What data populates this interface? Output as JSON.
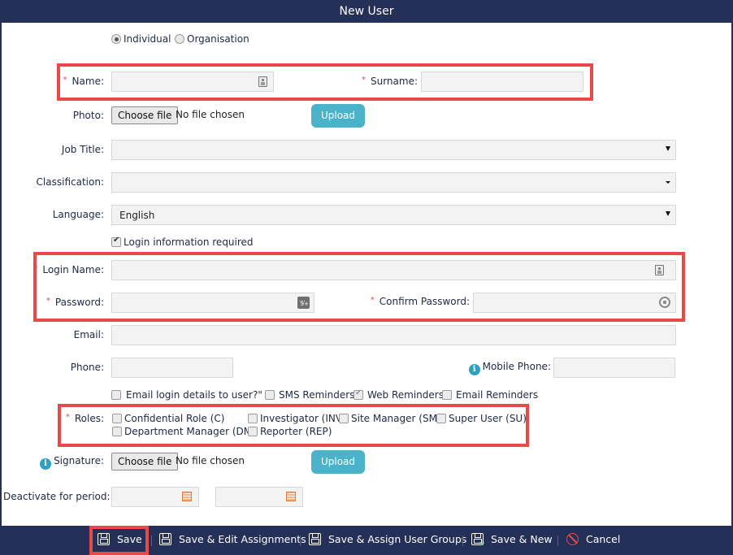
{
  "window": {
    "title": "New User"
  },
  "user_type": {
    "options": [
      {
        "label": "Individual",
        "selected": true
      },
      {
        "label": "Organisation",
        "selected": false
      }
    ]
  },
  "fields": {
    "name": {
      "label": "Name:",
      "required": "*",
      "value": ""
    },
    "surname": {
      "label": "Surname:",
      "required": "*",
      "value": ""
    },
    "photo": {
      "label": "Photo:",
      "choose_label": "Choose file",
      "status": "No file chosen",
      "upload_label": "Upload"
    },
    "job_title": {
      "label": "Job Title:",
      "value": ""
    },
    "classification": {
      "label": "Classification:",
      "value": ""
    },
    "language": {
      "label": "Language:",
      "value": "English"
    },
    "login_required": {
      "label": "Login information required",
      "checked": true
    },
    "login_name": {
      "label": "Login Name:",
      "required": "*",
      "value": ""
    },
    "password": {
      "label": "Password:",
      "required": "*",
      "value": ""
    },
    "confirm_password": {
      "label": "Confirm Password:",
      "required": "*",
      "value": ""
    },
    "email": {
      "label": "Email:",
      "value": ""
    },
    "phone": {
      "label": "Phone:",
      "value": ""
    },
    "mobile_phone": {
      "label": "Mobile Phone:",
      "value": ""
    },
    "signature": {
      "label": "Signature:",
      "choose_label": "Choose file",
      "status": "No file chosen",
      "upload_label": "Upload"
    },
    "deactivate": {
      "label": "Deactivate for period:",
      "from": "",
      "to": ""
    }
  },
  "notifications": [
    {
      "label": "Email login details to user?\"",
      "checked": false
    },
    {
      "label": "SMS Reminders",
      "checked": false
    },
    {
      "label": "Web Reminders",
      "checked": true
    },
    {
      "label": "Email Reminders",
      "checked": false
    }
  ],
  "roles": {
    "label": "Roles:",
    "required": "*",
    "items": [
      {
        "label": "Confidential Role (C)",
        "checked": false
      },
      {
        "label": "Investigator (INV)",
        "checked": false
      },
      {
        "label": "Site Manager (SM)",
        "checked": false
      },
      {
        "label": "Super User (SU)",
        "checked": false
      },
      {
        "label": "Department Manager (DM)",
        "checked": false
      },
      {
        "label": "Reporter (REP)",
        "checked": false
      }
    ]
  },
  "footer": {
    "buttons": [
      {
        "label": "Save",
        "icon": "floppy-disk-icon"
      },
      {
        "label": "Save & Edit Assignments",
        "icon": "floppy-disk-icon"
      },
      {
        "label": "Save & Assign User Groups",
        "icon": "floppy-disk-icon"
      },
      {
        "label": "Save & New",
        "icon": "floppy-disk-plus-icon"
      },
      {
        "label": "Cancel",
        "icon": "cancel-icon"
      }
    ]
  },
  "colors": {
    "header_bg": "#243057",
    "highlight": "#e84a4a",
    "upload_button": "#4ab3c9",
    "info_icon": "#2fa1bc",
    "required": "#e8474a"
  }
}
